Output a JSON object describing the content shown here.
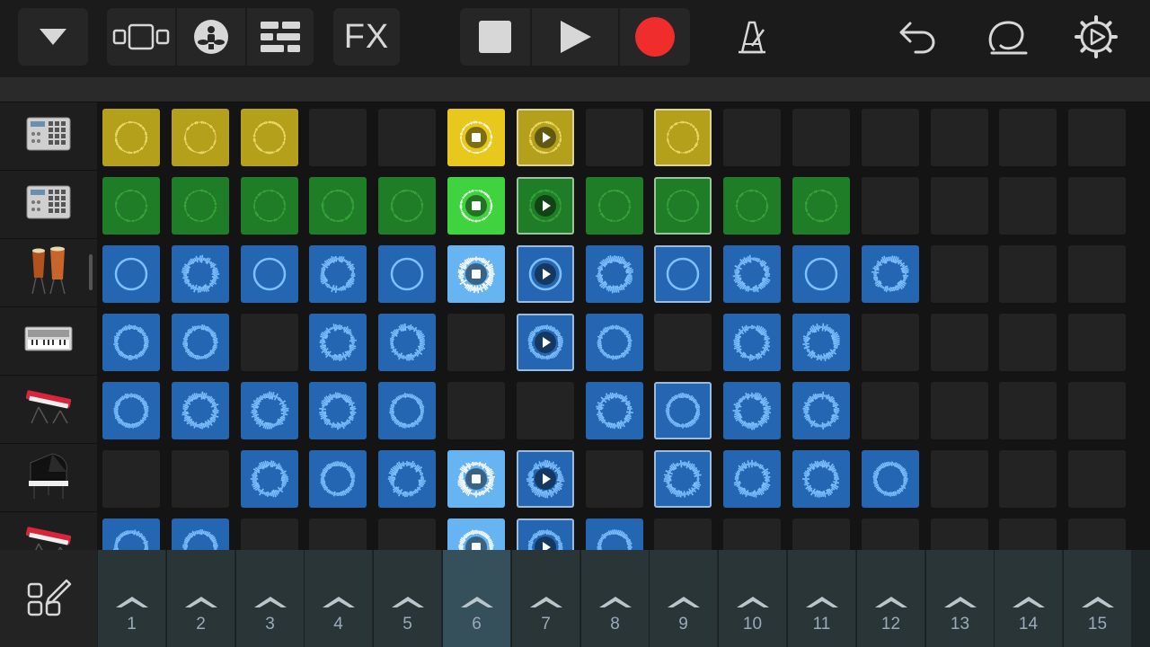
{
  "toolbar": {
    "fx_label": "FX",
    "icons": [
      "dropdown-icon",
      "tracks-view-icon",
      "drummer-icon",
      "mixer-icon",
      "stop-icon",
      "play-icon",
      "record-icon",
      "metronome-icon",
      "undo-icon",
      "loop-browser-icon",
      "settings-icon"
    ],
    "colors": {
      "record": "#ef2d2d",
      "button_bg": "#262626"
    }
  },
  "tracks": [
    {
      "name": "beat-sequencer-1",
      "icon": "drum-machine-icon"
    },
    {
      "name": "beat-sequencer-2",
      "icon": "drum-machine-icon"
    },
    {
      "name": "congas",
      "icon": "congas-icon"
    },
    {
      "name": "synth",
      "icon": "synth-icon"
    },
    {
      "name": "keyboard-red-1",
      "icon": "keyboard-icon"
    },
    {
      "name": "grand-piano",
      "icon": "piano-icon"
    },
    {
      "name": "keyboard-red-2",
      "icon": "keyboard-icon"
    }
  ],
  "grid": {
    "rows": [
      [
        "y",
        "y",
        "y",
        "e",
        "e",
        "Y",
        "yq",
        "e",
        "yq",
        "e",
        "e",
        "e",
        "e",
        "e",
        "e"
      ],
      [
        "g",
        "g",
        "g",
        "g",
        "g",
        "G",
        "gq",
        "g",
        "gq",
        "g",
        "g",
        "e",
        "e",
        "e",
        "e"
      ],
      [
        "b",
        "b",
        "b",
        "b",
        "b",
        "B",
        "bq",
        "b",
        "bq",
        "b",
        "b",
        "b",
        "e",
        "e",
        "e"
      ],
      [
        "b",
        "b",
        "e",
        "b",
        "b",
        "e",
        "bq",
        "b",
        "e",
        "b",
        "b",
        "e",
        "e",
        "e",
        "e"
      ],
      [
        "b",
        "b",
        "b",
        "b",
        "b",
        "e",
        "e",
        "b",
        "bq",
        "b",
        "b",
        "e",
        "e",
        "e",
        "e"
      ],
      [
        "e",
        "e",
        "b",
        "b",
        "b",
        "B",
        "bq",
        "e",
        "bq",
        "b",
        "b",
        "b",
        "e",
        "e",
        "e"
      ],
      [
        "b",
        "b",
        "e",
        "e",
        "e",
        "B",
        "bq",
        "b",
        "e",
        "e",
        "e",
        "e",
        "e",
        "e",
        "e"
      ]
    ],
    "colors": {
      "yellow": "#b5a01c",
      "green": "#1e7d26",
      "blue": "#2566b2",
      "empty": "#232323"
    }
  },
  "columns": [
    "1",
    "2",
    "3",
    "4",
    "5",
    "6",
    "7",
    "8",
    "9",
    "10",
    "11",
    "12",
    "13",
    "14",
    "15"
  ],
  "active_column_index": 5,
  "bottom": {
    "edit_icon": "edit-cells-icon"
  }
}
